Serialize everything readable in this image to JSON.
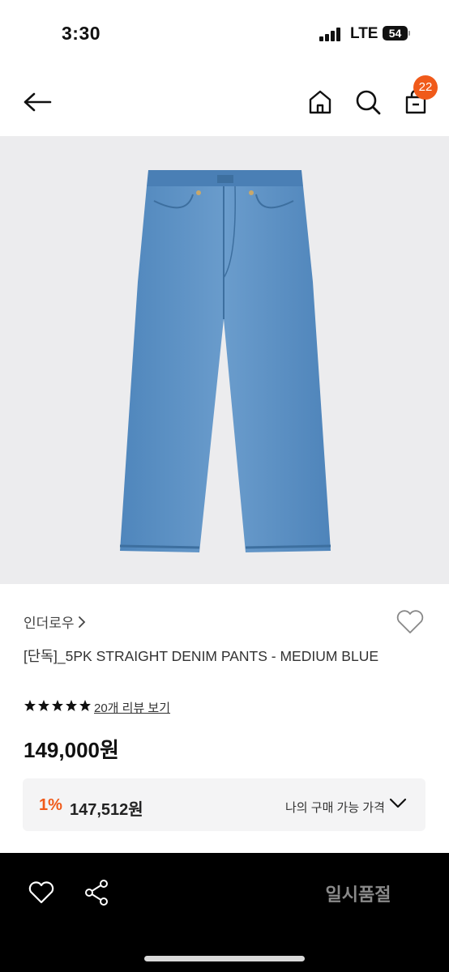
{
  "status_bar": {
    "time": "3:30",
    "network": "LTE",
    "battery": "54"
  },
  "header": {
    "cart_count": "22"
  },
  "product": {
    "brand": "인더로우",
    "title": "[단독]_5PK STRAIGHT DENIM PANTS - MEDIUM BLUE",
    "rating": 5,
    "review_link": "20개 리뷰 보기",
    "price": "149,000원",
    "discount": {
      "rate": "1%",
      "price": "147,512원",
      "label": "나의 구매 가능 가격"
    }
  },
  "bottom_bar": {
    "sold_out_label": "일시품절"
  },
  "colors": {
    "accent": "#f05a1a",
    "denim": "#5b8fc2"
  }
}
